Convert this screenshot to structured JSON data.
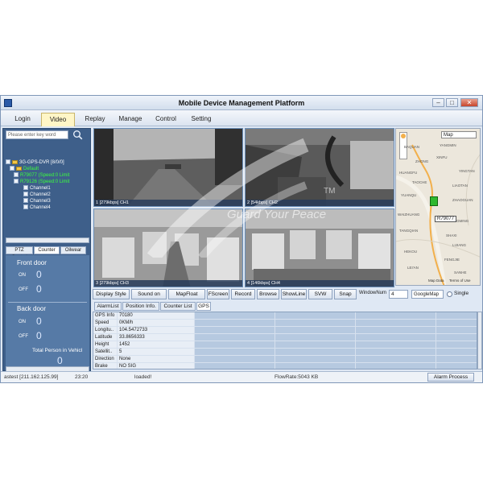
{
  "window": {
    "title": "Mobile Device Management Platform"
  },
  "menu": {
    "items": [
      "Login",
      "Video",
      "Replay",
      "Manage",
      "Control",
      "Setting"
    ],
    "active": "Video"
  },
  "search": {
    "placeholder": "Please enter key word"
  },
  "tree": {
    "root": "3G-GPS-DVR [8/0/0]",
    "group": "Default",
    "devices": [
      "R79077 (Speed:0 Limit",
      "R79126 (Speed:0 Limit"
    ],
    "channels": [
      "Channel1",
      "Channel2",
      "Channel3",
      "Channel4"
    ]
  },
  "ptz_tabs": [
    "PTZ Control",
    "Counter",
    "Oilwear"
  ],
  "counter": {
    "front_title": "Front door",
    "front_on_label": "ON",
    "front_on": "0",
    "front_off_label": "OFF",
    "front_off": "0",
    "back_title": "Back door",
    "back_on_label": "ON",
    "back_on": "0",
    "back_off_label": "OFF",
    "back_off": "0",
    "total_label": "Total Person in Vehicl",
    "total": "0"
  },
  "videos": [
    {
      "caption": "1 [279kbps] CH1"
    },
    {
      "caption": "2 [54kbps] CH2"
    },
    {
      "caption": "3 [279kbps] CH3"
    },
    {
      "caption": "4 [146kbps] CH4"
    }
  ],
  "map": {
    "type_select": "Map",
    "marker": "R79077",
    "places": [
      "BAQUAN",
      "YANGMIN",
      "XINFU",
      "ZHONG",
      "HUANGFU",
      "YINGTAN",
      "LIAOTAN",
      "TAOCHE",
      "YUANQU",
      "ZHAOGUAN",
      "WAIZHUANG",
      "GUANGMING",
      "TANGQIAN",
      "SHAXI",
      "LIJIANG",
      "HEKOU",
      "FENGJIE",
      "LEI'AN",
      "SANHE"
    ],
    "attribution": "Map Data",
    "terms": "Terms of Use"
  },
  "toolbar": {
    "buttons": [
      "Display Style",
      "Sound on",
      "MapFloat",
      "FScreen",
      "Record",
      "Browse",
      "ShowLine",
      "SVW",
      "Snap"
    ],
    "window_num_label": "WindowNum",
    "window_num": "4",
    "map_provider": "GoogleMap",
    "single_label": "Single"
  },
  "info_tabs": [
    "AlarmList",
    "Position Info.",
    "Counter List",
    "GPS"
  ],
  "gps": {
    "rows": [
      [
        "GPS Info",
        "70180"
      ],
      [
        "Speed",
        "0KM/h"
      ],
      [
        "Longitu..",
        "104.5472733"
      ],
      [
        "Latitude",
        "33.8656333"
      ],
      [
        "Height",
        "1452"
      ],
      [
        "Satellit..",
        "5"
      ],
      [
        "Direction",
        "None"
      ],
      [
        "Brake",
        "NO SIG"
      ]
    ]
  },
  "status": {
    "user": "astest [211.162.125.99]",
    "time": "23:20",
    "state": "loaded!",
    "flow": "FlowRate:5043 KB",
    "alarm_button": "Alarm Process"
  },
  "watermark": {
    "slogan": "Guard Your Peace",
    "tm": "TM"
  }
}
